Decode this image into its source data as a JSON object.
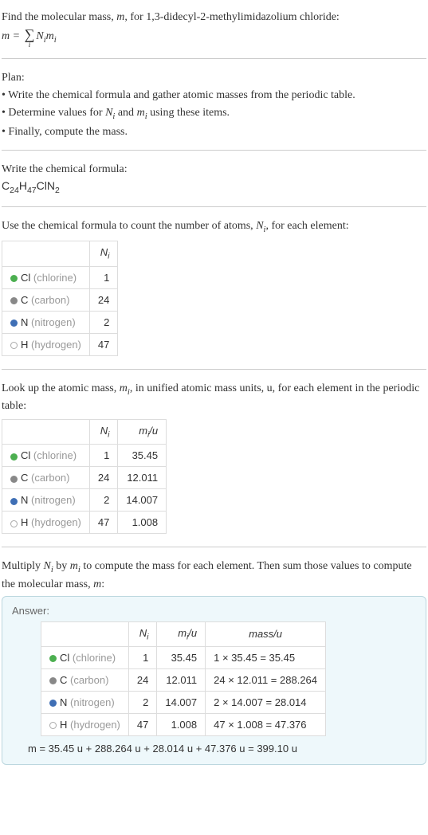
{
  "intro": {
    "line1_pre": "Find the molecular mass, ",
    "line1_m": "m",
    "line1_post": ", for 1,3-didecyl-2-methylimidazolium chloride:",
    "eq_lhs": "m = ",
    "eq_rhs_N": "N",
    "eq_rhs_m": "m",
    "eq_sub_i": "i"
  },
  "plan": {
    "header": "Plan:",
    "b1": "• Write the chemical formula and gather atomic masses from the periodic table.",
    "b2_pre": "• Determine values for ",
    "b2_N": "N",
    "b2_and": " and ",
    "b2_m": "m",
    "b2_post": " using these items.",
    "b3": "• Finally, compute the mass."
  },
  "formula_section": {
    "header": "Write the chemical formula:",
    "C": "C",
    "Cn": "24",
    "H": "H",
    "Hn": "47",
    "Cl": "Cl",
    "N": "N",
    "Nn": "2"
  },
  "count_section": {
    "header_pre": "Use the chemical formula to count the number of atoms, ",
    "header_N": "N",
    "header_post": ", for each element:",
    "col_N": "N",
    "col_i": "i",
    "rows": [
      {
        "dot": "dot-cl",
        "sym": "Cl",
        "name": "(chlorine)",
        "n": "1"
      },
      {
        "dot": "dot-c",
        "sym": "C",
        "name": "(carbon)",
        "n": "24"
      },
      {
        "dot": "dot-n",
        "sym": "N",
        "name": "(nitrogen)",
        "n": "2"
      },
      {
        "dot": "dot-h",
        "sym": "H",
        "name": "(hydrogen)",
        "n": "47"
      }
    ]
  },
  "mass_section": {
    "header_pre": "Look up the atomic mass, ",
    "header_m": "m",
    "header_post": ", in unified atomic mass units, u, for each element in the periodic table:",
    "col_N": "N",
    "col_i": "i",
    "col_m": "m",
    "col_mu": "/u",
    "rows": [
      {
        "dot": "dot-cl",
        "sym": "Cl",
        "name": "(chlorine)",
        "n": "1",
        "m": "35.45"
      },
      {
        "dot": "dot-c",
        "sym": "C",
        "name": "(carbon)",
        "n": "24",
        "m": "12.011"
      },
      {
        "dot": "dot-n",
        "sym": "N",
        "name": "(nitrogen)",
        "n": "2",
        "m": "14.007"
      },
      {
        "dot": "dot-h",
        "sym": "H",
        "name": "(hydrogen)",
        "n": "47",
        "m": "1.008"
      }
    ]
  },
  "final": {
    "para_pre": "Multiply ",
    "para_N": "N",
    "para_by": " by ",
    "para_m": "m",
    "para_mid": " to compute the mass for each element. Then sum those values to compute the molecular mass, ",
    "para_mm": "m",
    "para_post": ":",
    "answer_label": "Answer:",
    "col_N": "N",
    "col_i": "i",
    "col_m": "m",
    "col_mu": "/u",
    "col_mass": "mass/u",
    "rows": [
      {
        "dot": "dot-cl",
        "sym": "Cl",
        "name": "(chlorine)",
        "n": "1",
        "m": "35.45",
        "mass": "1 × 35.45 = 35.45"
      },
      {
        "dot": "dot-c",
        "sym": "C",
        "name": "(carbon)",
        "n": "24",
        "m": "12.011",
        "mass": "24 × 12.011 = 288.264"
      },
      {
        "dot": "dot-n",
        "sym": "N",
        "name": "(nitrogen)",
        "n": "2",
        "m": "14.007",
        "mass": "2 × 14.007 = 28.014"
      },
      {
        "dot": "dot-h",
        "sym": "H",
        "name": "(hydrogen)",
        "n": "47",
        "m": "1.008",
        "mass": "47 × 1.008 = 47.376"
      }
    ],
    "eq": "m = 35.45 u + 288.264 u + 28.014 u + 47.376 u = 399.10 u"
  }
}
